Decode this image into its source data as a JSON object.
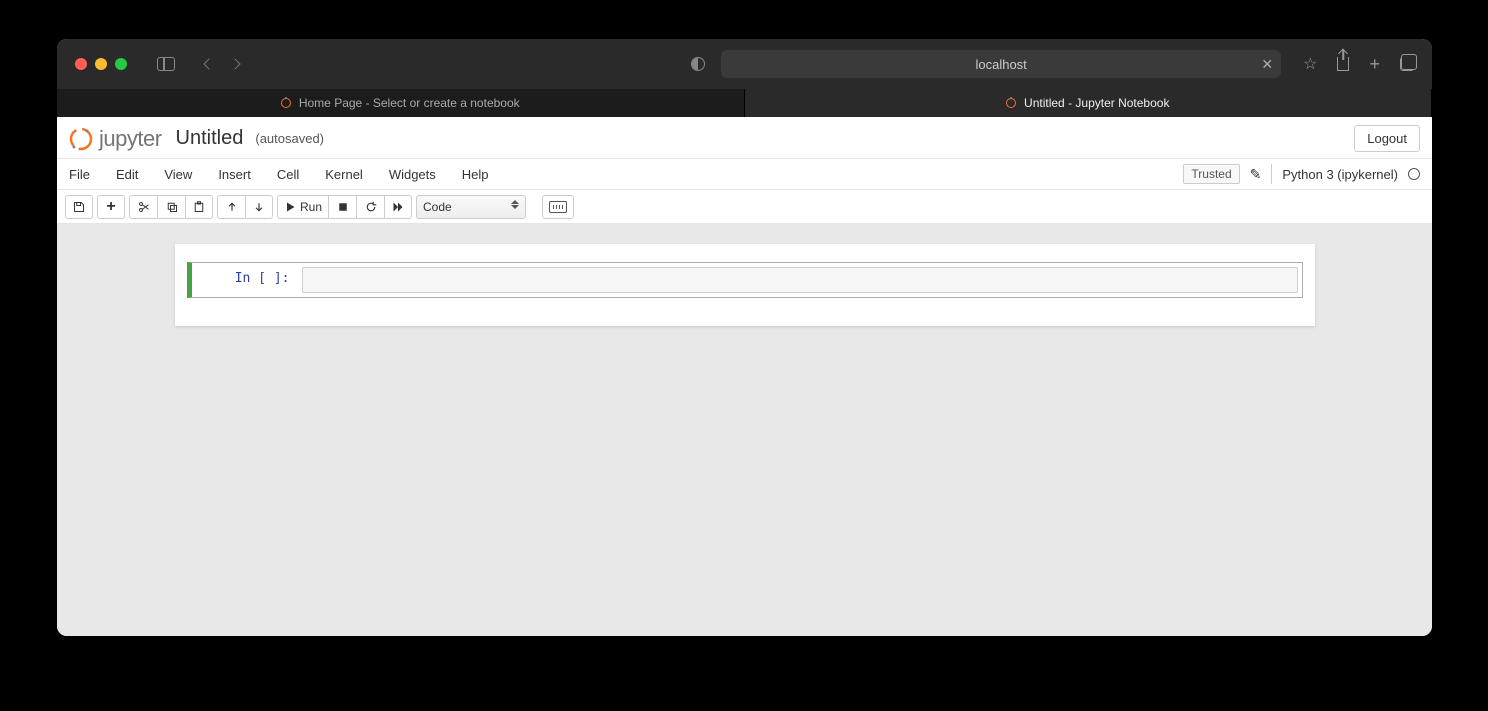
{
  "browser": {
    "url_display": "localhost",
    "tabs": [
      {
        "label": "Home Page - Select or create a notebook",
        "active": false
      },
      {
        "label": "Untitled - Jupyter Notebook",
        "active": true
      }
    ]
  },
  "header": {
    "logo_text": "jupyter",
    "notebook_title": "Untitled",
    "autosave_label": "(autosaved)",
    "logout_label": "Logout"
  },
  "menus": {
    "file": "File",
    "edit": "Edit",
    "view": "View",
    "insert": "Insert",
    "cell": "Cell",
    "kernel": "Kernel",
    "widgets": "Widgets",
    "help": "Help"
  },
  "status": {
    "trusted_label": "Trusted",
    "kernel_name": "Python 3 (ipykernel)"
  },
  "toolbar": {
    "run_label": "Run",
    "celltype_value": "Code"
  },
  "cell": {
    "prompt": "In [ ]:",
    "content": ""
  }
}
